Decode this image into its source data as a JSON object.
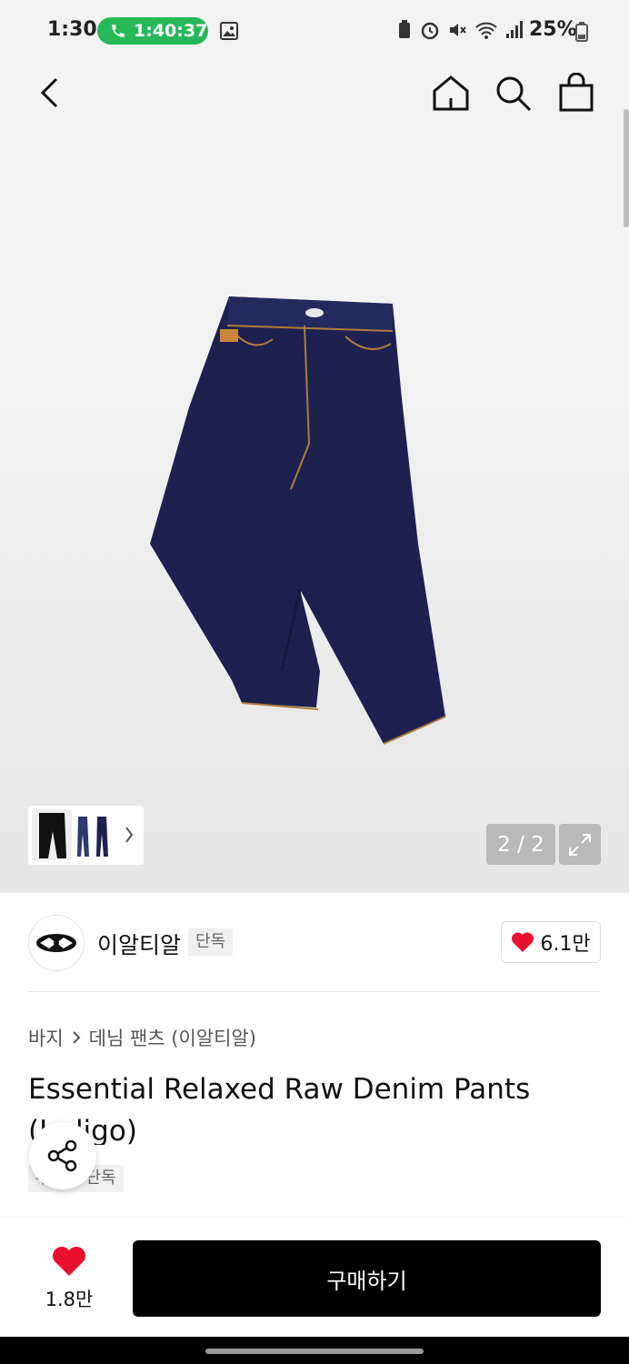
{
  "status_bar": {
    "time": "1:30",
    "call_timer": "1:40:37",
    "battery": "25%"
  },
  "gallery": {
    "counter": "2 / 2"
  },
  "brand": {
    "name": "이알티알",
    "badge": "단독",
    "likes": "6.1만"
  },
  "breadcrumb": {
    "category": "바지",
    "subcategory": "데님 팬츠 (이알티알)"
  },
  "product": {
    "title": "Essential Relaxed Raw Denim Pants (Indigo)",
    "tag": "무신사 단독"
  },
  "bottom_bar": {
    "wish_count": "1.8만",
    "buy_label": "구매하기"
  },
  "colors": {
    "accent_red": "#e8112d",
    "call_green": "#27b85a",
    "denim": "#1d2150"
  }
}
